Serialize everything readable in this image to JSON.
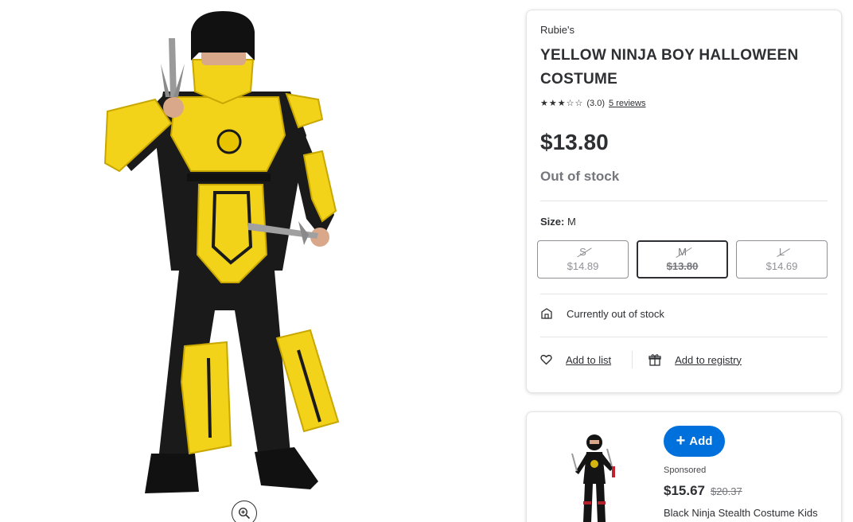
{
  "product": {
    "brand": "Rubie's",
    "title": "YELLOW NINJA BOY HALLOWEEN COSTUME",
    "rating_value": "(3.0)",
    "stars_filled": 3,
    "stars_total": 5,
    "reviews_text": "5 reviews",
    "price": "$13.80",
    "stock_status": "Out of stock",
    "size_label": "Size:",
    "size_selected": "M",
    "sizes": [
      {
        "name": "S",
        "price": "$14.89"
      },
      {
        "name": "M",
        "price": "$13.80"
      },
      {
        "name": "L",
        "price": "$14.69"
      }
    ],
    "availability_text": "Currently out of stock",
    "add_to_list": "Add to list",
    "add_to_registry": "Add to registry"
  },
  "sponsored_item": {
    "add_button": "Add",
    "sponsored_label": "Sponsored",
    "price": "$15.67",
    "was_price": "$20.37",
    "name": "Black Ninja Stealth Costume Kids"
  },
  "icons": {
    "zoom": "zoom-in-icon",
    "store": "store-icon",
    "heart": "heart-icon",
    "gift": "gift-icon",
    "plus": "plus-icon"
  },
  "colors": {
    "accent_blue": "#0071dc",
    "text_primary": "#2e2f32",
    "text_muted": "#74767c",
    "border": "#e3e4e5",
    "costume_yellow": "#f3d21a"
  }
}
